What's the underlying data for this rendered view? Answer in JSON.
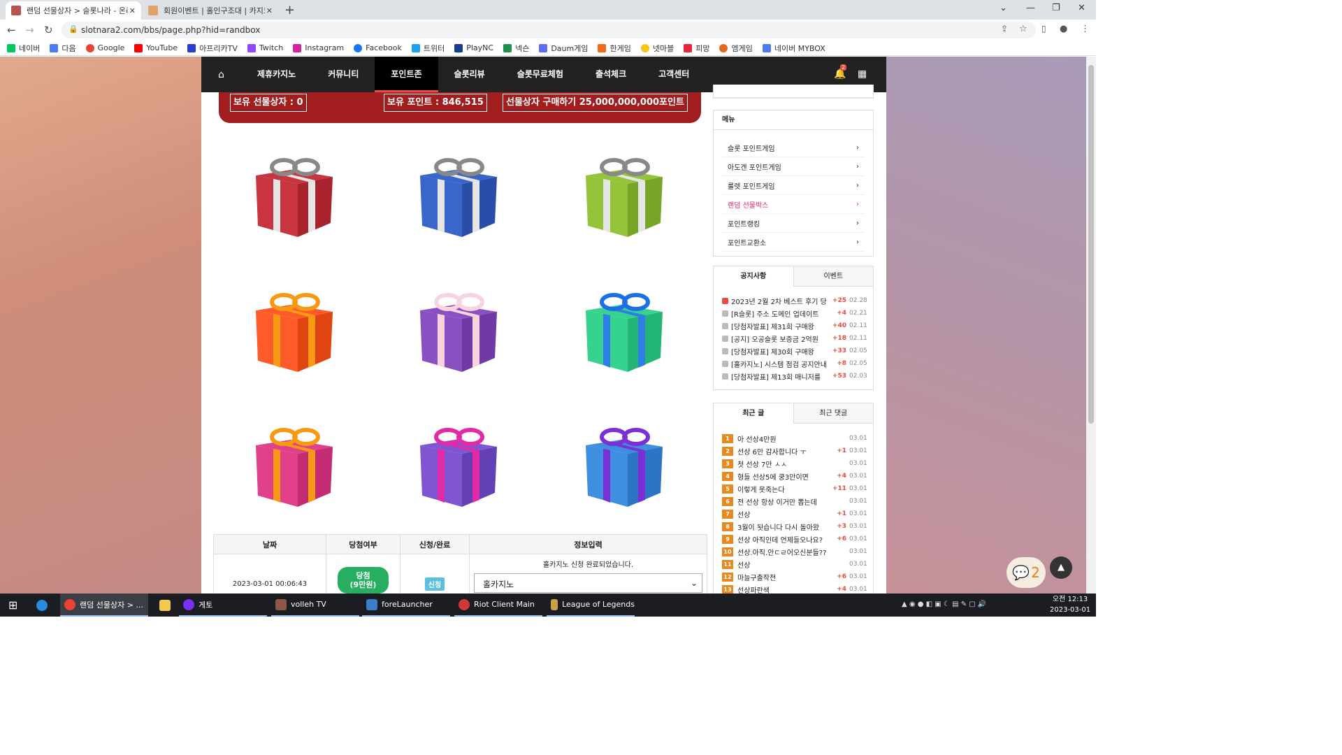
{
  "browser": {
    "tabs": [
      {
        "title": "랜덤 선물상자 > 슬롯나라 - 온라",
        "active": true
      },
      {
        "title": "회원이벤트 | 홀인구조대 | 카지노",
        "active": false
      }
    ],
    "url": "slotnara2.com/bbs/page.php?hid=randbox",
    "bookmarks": [
      "네이버",
      "다음",
      "Google",
      "YouTube",
      "아프리카TV",
      "Twitch",
      "Instagram",
      "Facebook",
      "트위터",
      "PlayNC",
      "넥슨",
      "Daum게임",
      "한게임",
      "넷마블",
      "피망",
      "엠게임",
      "네이버 MYBOX"
    ]
  },
  "nav": {
    "items": [
      "제휴카지노",
      "커뮤니티",
      "포인트존",
      "슬롯리뷰",
      "슬롯무료체험",
      "출석체크",
      "고객센터"
    ],
    "active": "포인트존",
    "bell_count": "2"
  },
  "banner": {
    "owned_boxes": "보유 선물상자 : 0",
    "owned_points": "보유 포인트 : 846,515",
    "buy_box": "선물상자 구매하기 25,000,000,000포인트"
  },
  "gifts": [
    {
      "box": "#c8343f",
      "dark": "#a8232e",
      "ribbon": "#e6e6e6",
      "bow": "#888888"
    },
    {
      "box": "#3a66c9",
      "dark": "#2a4ea8",
      "ribbon": "#e6e6e6",
      "bow": "#888888"
    },
    {
      "box": "#94c43a",
      "dark": "#78a528",
      "ribbon": "#e6e6e6",
      "bow": "#888888"
    },
    {
      "box": "#ff5a2a",
      "dark": "#e04410",
      "ribbon": "#f59a12",
      "bow": "#f59a12"
    },
    {
      "box": "#8a4fc0",
      "dark": "#6f3aa3",
      "ribbon": "#f7d4df",
      "bow": "#f7d4df"
    },
    {
      "box": "#35d38e",
      "dark": "#22b575",
      "ribbon": "#2f7de6",
      "bow": "#1c6fe8"
    },
    {
      "box": "#e0418a",
      "dark": "#c32c72",
      "ribbon": "#f59a12",
      "bow": "#f59a12"
    },
    {
      "box": "#7f55d2",
      "dark": "#6440b5",
      "ribbon": "#e22aa6",
      "bow": "#e22aa6"
    },
    {
      "box": "#3f8fe0",
      "dark": "#2c74c4",
      "ribbon": "#7b2fd6",
      "bow": "#7b2fd6"
    }
  ],
  "results": {
    "headers": [
      "날짜",
      "당첨여부",
      "신청/완료",
      "정보입력"
    ],
    "row": {
      "date": "2023-03-01 00:06:43",
      "win_line1": "당첨",
      "win_line2": "(9만원)",
      "status": "신청",
      "notice": "홀카지노 신청 완료되었습니다.",
      "select": "홀카지노"
    }
  },
  "sidebar": {
    "menu_title": "메뉴",
    "menu": [
      {
        "label": "슬롯 포인트게임",
        "active": false
      },
      {
        "label": "아도겐 포인트게임",
        "active": false
      },
      {
        "label": "룰렛 포인트게임",
        "active": false
      },
      {
        "label": "랜덤 선물박스",
        "active": true
      },
      {
        "label": "포인트랭킹",
        "active": false
      },
      {
        "label": "포인트교환소",
        "active": false
      }
    ],
    "notice_tabs": [
      "공지사항",
      "이벤트"
    ],
    "notices": [
      {
        "title": "2023년 2월 2차 베스트 후기 당",
        "comments": "+25",
        "date": "02.28",
        "new": true
      },
      {
        "title": "[R슬롯] 주소 도메인 업데이트",
        "comments": "+4",
        "date": "02.21",
        "new": false
      },
      {
        "title": "[당첨자발표] 제31회 구매왕",
        "comments": "+40",
        "date": "02.11",
        "new": false
      },
      {
        "title": "[공지] 오공슬롯 보증금 2억원",
        "comments": "+18",
        "date": "02.11",
        "new": false
      },
      {
        "title": "[당첨자발표] 제30회 구매왕",
        "comments": "+33",
        "date": "02.05",
        "new": false
      },
      {
        "title": "[홀카지노] 시스템 점검 공지안내",
        "comments": "+8",
        "date": "02.05",
        "new": false
      },
      {
        "title": "[당첨자발표] 제13회 매니저를",
        "comments": "+53",
        "date": "02.03",
        "new": false
      }
    ],
    "recent_tabs": [
      "최근 글",
      "최근 댓글"
    ],
    "recent": [
      {
        "rank": "1",
        "title": "아 선상4만원",
        "comments": "",
        "date": "03.01"
      },
      {
        "rank": "2",
        "title": "선상 6만 감사합니다 ㅜ",
        "comments": "+1",
        "date": "03.01"
      },
      {
        "rank": "3",
        "title": "첫 선상 7만 ㅅㅅ",
        "comments": "",
        "date": "03.01"
      },
      {
        "rank": "4",
        "title": "형들 선상5에 쿵3만이면",
        "comments": "+4",
        "date": "03.01"
      },
      {
        "rank": "5",
        "title": "이렇게 못죽는다",
        "comments": "+11",
        "date": "03.01"
      },
      {
        "rank": "6",
        "title": "전 선상 항상 이거만 뽑는데",
        "comments": "",
        "date": "03.01"
      },
      {
        "rank": "7",
        "title": "선상",
        "comments": "+1",
        "date": "03.01"
      },
      {
        "rank": "8",
        "title": "3월이 됫습니다 다시 돌아왔",
        "comments": "+3",
        "date": "03.01"
      },
      {
        "rank": "9",
        "title": "선상 아직인데 언제들오나요?",
        "comments": "+6",
        "date": "03.01"
      },
      {
        "rank": "10",
        "title": "선상.아직.안ㄷㄹ어오신분들??",
        "comments": "",
        "date": "03.01"
      },
      {
        "rank": "11",
        "title": "선상",
        "comments": "",
        "date": "03.01"
      },
      {
        "rank": "12",
        "title": "마늘구출작전",
        "comments": "+6",
        "date": "03.01"
      },
      {
        "rank": "13",
        "title": "선상파란색",
        "comments": "+4",
        "date": "03.01"
      }
    ]
  },
  "chat_count": "2",
  "taskbar": {
    "apps": [
      "랜덤 선물상자 > ...",
      "게토",
      "volleh TV",
      "foreLauncher",
      "Riot Client Main",
      "League of Legends"
    ],
    "time": "오전 12:13",
    "date": "2023-03-01"
  }
}
